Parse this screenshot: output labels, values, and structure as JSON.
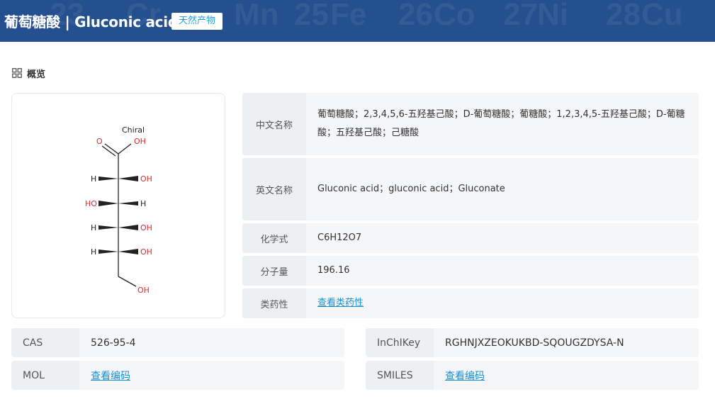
{
  "header": {
    "title": "葡萄糖酸 | Gluconic acid",
    "badge": "天然产物",
    "bg_elements": [
      "23",
      "Cr",
      "Mn",
      "25",
      "Fe",
      "26",
      "Co",
      "27",
      "Ni",
      "28",
      "Cu"
    ]
  },
  "section": {
    "title": "概览"
  },
  "structure": {
    "chiral": "Chiral",
    "labels": {
      "O": "O",
      "OH_top": "OH",
      "H1": "H",
      "OH1": "OH",
      "HO2": "HO",
      "H2": "H",
      "H3": "H",
      "OH3": "OH",
      "H4": "H",
      "OH4": "OH",
      "OH_bottom": "OH"
    }
  },
  "properties": [
    {
      "key": "中文名称",
      "value": "葡萄糖酸；2,3,4,5,6-五羟基己酸；D-葡萄糖酸；葡糖酸；1,2,3,4,5-五羟基己酸；D-葡糖酸；五羟基己酸；己糖酸"
    },
    {
      "key": "英文名称",
      "value": "Gluconic acid；gluconic acid；Gluconate"
    },
    {
      "key": "化学式",
      "value": "C6H12O7"
    },
    {
      "key": "分子量",
      "value": "196.16"
    },
    {
      "key": "类药性",
      "value": "查看类药性"
    }
  ],
  "identifiers": {
    "cas": {
      "key": "CAS",
      "value": "526-95-4"
    },
    "inchikey": {
      "key": "InChIKey",
      "value": "RGHNJXZEOKUKBD-SQOUGZDYSA-N"
    },
    "mol": {
      "key": "MOL",
      "value": "查看编码"
    },
    "smiles": {
      "key": "SMILES",
      "value": "查看编码"
    }
  },
  "colors": {
    "header_bg": "#24508f",
    "link": "#1a8fcf",
    "oxygen": "#e0282a"
  }
}
